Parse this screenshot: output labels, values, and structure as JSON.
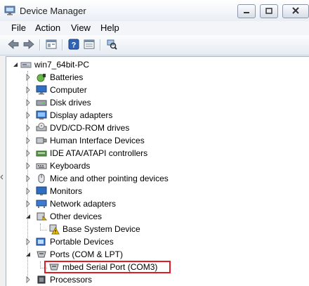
{
  "window": {
    "title": "Device Manager",
    "controls": {
      "minimize_icon": "minimize-icon",
      "maximize_icon": "maximize-icon",
      "close_icon": "close-icon"
    }
  },
  "menu": [
    "File",
    "Action",
    "View",
    "Help"
  ],
  "toolbar": {
    "buttons": [
      "back-arrow-icon",
      "forward-arrow-icon",
      "properties-pane-icon",
      "help-icon",
      "show-hide-pane-icon",
      "scan-hardware-icon"
    ]
  },
  "tree": {
    "root": "win7_64bit-PC",
    "items": [
      {
        "label": "Batteries",
        "icon": "battery-icon",
        "expanded": false
      },
      {
        "label": "Computer",
        "icon": "computer-icon",
        "expanded": false
      },
      {
        "label": "Disk drives",
        "icon": "disk-drive-icon",
        "expanded": false
      },
      {
        "label": "Display adapters",
        "icon": "display-adapter-icon",
        "expanded": false
      },
      {
        "label": "DVD/CD-ROM drives",
        "icon": "dvd-drive-icon",
        "expanded": false
      },
      {
        "label": "Human Interface Devices",
        "icon": "hid-icon",
        "expanded": false
      },
      {
        "label": "IDE ATA/ATAPI controllers",
        "icon": "ide-controller-icon",
        "expanded": false
      },
      {
        "label": "Keyboards",
        "icon": "keyboard-icon",
        "expanded": false
      },
      {
        "label": "Mice and other pointing devices",
        "icon": "mouse-icon",
        "expanded": false
      },
      {
        "label": "Monitors",
        "icon": "monitor-icon",
        "expanded": false
      },
      {
        "label": "Network adapters",
        "icon": "network-adapter-icon",
        "expanded": false
      },
      {
        "label": "Other devices",
        "icon": "other-devices-icon",
        "expanded": true,
        "children": [
          {
            "label": "Base System Device",
            "icon": "warning-device-icon"
          }
        ]
      },
      {
        "label": "Portable Devices",
        "icon": "portable-device-icon",
        "expanded": false
      },
      {
        "label": "Ports (COM & LPT)",
        "icon": "port-icon",
        "expanded": true,
        "children": [
          {
            "label": "mbed Serial Port (COM3)",
            "icon": "serial-port-icon",
            "highlighted": true
          }
        ]
      },
      {
        "label": "Processors",
        "icon": "processor-icon",
        "expanded": false
      }
    ]
  },
  "colors": {
    "highlight_border": "#e11d23",
    "tree_background": "#ffffff",
    "chrome": "#f0f0f0"
  }
}
